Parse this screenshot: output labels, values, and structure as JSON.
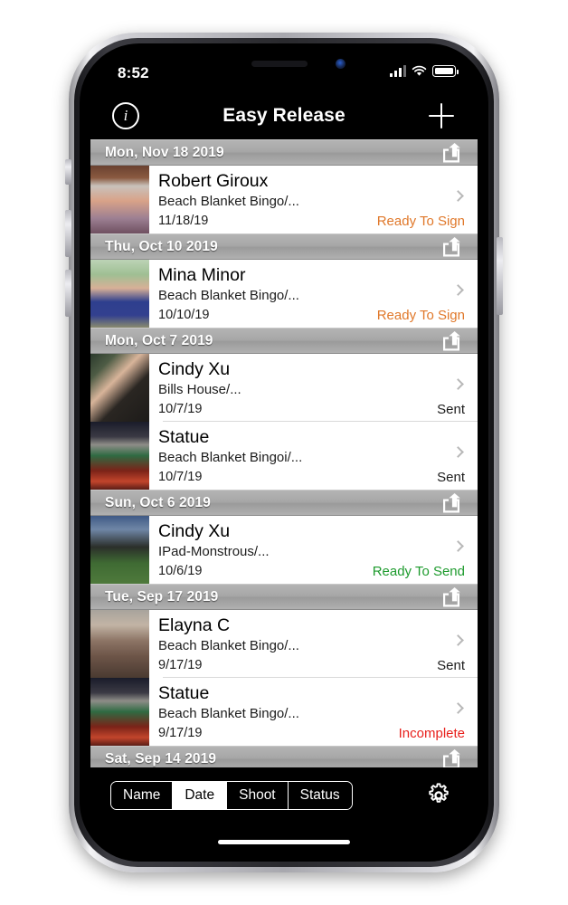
{
  "status_bar": {
    "time": "8:52",
    "signal_icon": "cellular-signal-icon",
    "wifi_icon": "wifi-icon",
    "battery_icon": "battery-icon"
  },
  "nav_bar": {
    "title": "Easy Release",
    "info_label": "i",
    "info_icon": "info-circle-icon",
    "add_icon": "plus-icon"
  },
  "colors": {
    "ready_to_sign": "#e0782a",
    "ready_to_send": "#1e9b2e",
    "sent": "#1c1c1c",
    "incomplete": "#e8201c",
    "header_text": "#ffffff"
  },
  "list": {
    "share_icon": "share-export-icon",
    "disclosure_icon": "chevron-right-icon",
    "sections": [
      {
        "header": "Mon, Nov 18 2019",
        "rows": [
          {
            "name": "Robert Giroux",
            "subtitle": "Beach Blanket Bingo/...",
            "date": "11/18/19",
            "status": "Ready To Sign",
            "status_color": "#e0782a",
            "thumb": "portrait-man-eclipse-glasses"
          }
        ]
      },
      {
        "header": "Thu, Oct 10 2019",
        "rows": [
          {
            "name": "Mina Minor",
            "subtitle": "Beach Blanket Bingo/...",
            "date": "10/10/19",
            "status": "Ready To Sign",
            "status_color": "#e0782a",
            "thumb": "portrait-woman-blue-dress"
          }
        ]
      },
      {
        "header": "Mon, Oct 7 2019",
        "rows": [
          {
            "name": "Cindy Xu",
            "subtitle": "Bills House/...",
            "date": "10/7/19",
            "status": "Sent",
            "status_color": "#1c1c1c",
            "thumb": "portrait-woman-dark-jacket"
          },
          {
            "name": "Statue",
            "subtitle": "Beach Blanket Bingoi/...",
            "date": "10/7/19",
            "status": "Sent",
            "status_color": "#1c1c1c",
            "thumb": "monument-night-lights"
          }
        ]
      },
      {
        "header": "Sun, Oct 6 2019",
        "rows": [
          {
            "name": "Cindy Xu",
            "subtitle": "IPad-Monstrous/...",
            "date": "10/6/19",
            "status": "Ready To Send",
            "status_color": "#1e9b2e",
            "thumb": "woman-field-rainbow"
          }
        ]
      },
      {
        "header": "Tue, Sep 17 2019",
        "rows": [
          {
            "name": "Elayna C",
            "subtitle": "Beach Blanket Bingo/...",
            "date": "9/17/19",
            "status": "Sent",
            "status_color": "#1c1c1c",
            "thumb": "woman-canyon-overlook"
          },
          {
            "name": "Statue",
            "subtitle": "Beach Blanket Bingo/...",
            "date": "9/17/19",
            "status": "Incomplete",
            "status_color": "#e8201c",
            "thumb": "monument-night-lights"
          }
        ]
      },
      {
        "header": "Sat, Sep 14 2019",
        "rows": []
      }
    ]
  },
  "toolbar": {
    "segments": [
      {
        "label": "Name",
        "selected": false
      },
      {
        "label": "Date",
        "selected": true
      },
      {
        "label": "Shoot",
        "selected": false
      },
      {
        "label": "Status",
        "selected": false
      }
    ],
    "settings_icon": "gear-icon"
  }
}
